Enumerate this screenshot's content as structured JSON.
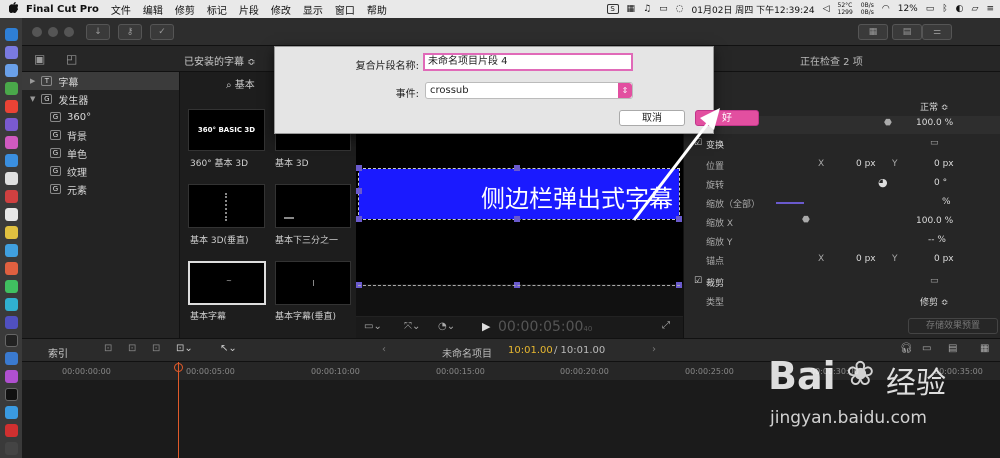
{
  "menubar": {
    "apple": "",
    "app": "Final Cut Pro",
    "items": [
      "文件",
      "编辑",
      "修剪",
      "标记",
      "片段",
      "修改",
      "显示",
      "窗口",
      "帮助"
    ],
    "status_sq": "S",
    "datetime": "01月02日 周四 下午12:39:24",
    "cpu_temp": "52°C",
    "cpu_rpm": "1299",
    "net_up": "0B/s",
    "net_down": "0B/s",
    "battery": "12%"
  },
  "library": {
    "filter_label": "已安装的字幕 ≎",
    "search_label": "基本",
    "inspect_status": "正在检查 2 项"
  },
  "sidebar": {
    "items": [
      {
        "label": "字幕",
        "icon": "T"
      },
      {
        "label": "发生器",
        "icon": "G"
      },
      {
        "label": "360°",
        "icon": "G"
      },
      {
        "label": "背景",
        "icon": "G"
      },
      {
        "label": "单色",
        "icon": "G"
      },
      {
        "label": "纹理",
        "icon": "G"
      },
      {
        "label": "元素",
        "icon": "G"
      }
    ]
  },
  "browser": {
    "thumbs": [
      {
        "label": "360° 基本 3D",
        "preview": "360° BASIC 3D"
      },
      {
        "label": "基本 3D",
        "preview": ""
      },
      {
        "label": "基本 3D(垂直)",
        "preview": ""
      },
      {
        "label": "基本下三分之一",
        "preview": ""
      },
      {
        "label": "基本字幕",
        "preview": "~"
      },
      {
        "label": "基本字幕(垂直)",
        "preview": ""
      }
    ]
  },
  "viewer": {
    "caption": "侧边栏弹出式字幕",
    "timecode": "00:00:05:00",
    "timecode_frames": "40",
    "caption_color": "#1a1aff"
  },
  "inspector": {
    "blend": "正常 ≎",
    "opacity": "100.0 %",
    "transform_label": "变换",
    "position_label": "位置",
    "pos_x_label": "X",
    "pos_x": "0 px",
    "pos_y_label": "Y",
    "pos_y": "0 px",
    "rotation_label": "旋转",
    "rotation": "0 °",
    "scale_all_label": "缩放（全部）",
    "scale_all": "%",
    "scale_x_label": "缩放 X",
    "scale_x": "100.0 %",
    "scale_y_label": "缩放 Y",
    "scale_y": "-- %",
    "anchor_label": "锚点",
    "anchor_x_label": "X",
    "anchor_x": "0 px",
    "anchor_y_label": "Y",
    "anchor_y": "0 px",
    "crop_label": "裁剪",
    "type_label": "类型",
    "type_value": "修剪 ≎",
    "save_preset": "存储效果预置"
  },
  "timeline": {
    "index_label": "索引",
    "project_name": "未命名项目",
    "duration_current": "10:01.00",
    "duration_total": "/ 10:01.00",
    "ticks": [
      "00:00:00:00",
      "00:00:05:00",
      "00:00:10:00",
      "00:00:15:00",
      "00:00:20:00",
      "00:00:25:00",
      "00:00:30:00",
      "00:00:35:00"
    ]
  },
  "dialog": {
    "name_label": "复合片段名称:",
    "name_value": "未命名项目片段 4",
    "event_label": "事件:",
    "event_value": "crossub",
    "cancel_label": "取消",
    "ok_label": "好",
    "accent": "#e24fa0"
  },
  "watermark": {
    "brand": "Bai",
    "brand2": "经验",
    "url": "jingyan.baidu.com"
  }
}
